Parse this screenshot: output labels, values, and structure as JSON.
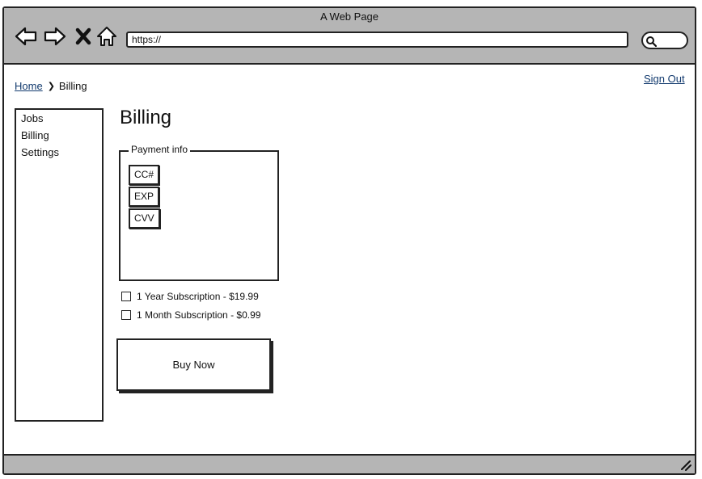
{
  "window": {
    "title": "A Web Page"
  },
  "toolbar": {
    "icons": [
      "back-arrow-icon",
      "forward-arrow-icon",
      "close-x-icon",
      "home-icon",
      "search-icon"
    ],
    "url": "https://"
  },
  "breadcrumb": {
    "home": "Home",
    "current": "Billing",
    "separator": "❯"
  },
  "header": {
    "signout": "Sign Out"
  },
  "sidebar": {
    "items": [
      {
        "label": "Jobs"
      },
      {
        "label": "Billing"
      },
      {
        "label": "Settings"
      }
    ]
  },
  "main": {
    "title": "Billing",
    "payment": {
      "legend": "Payment info",
      "fields": [
        {
          "label": "CC#"
        },
        {
          "label": "EXP"
        },
        {
          "label": "CVV"
        }
      ]
    },
    "options": [
      {
        "label": "1 Year Subscription - $19.99",
        "checked": false
      },
      {
        "label": "1 Month Subscription - $0.99",
        "checked": false
      }
    ],
    "buy_label": "Buy Now"
  }
}
